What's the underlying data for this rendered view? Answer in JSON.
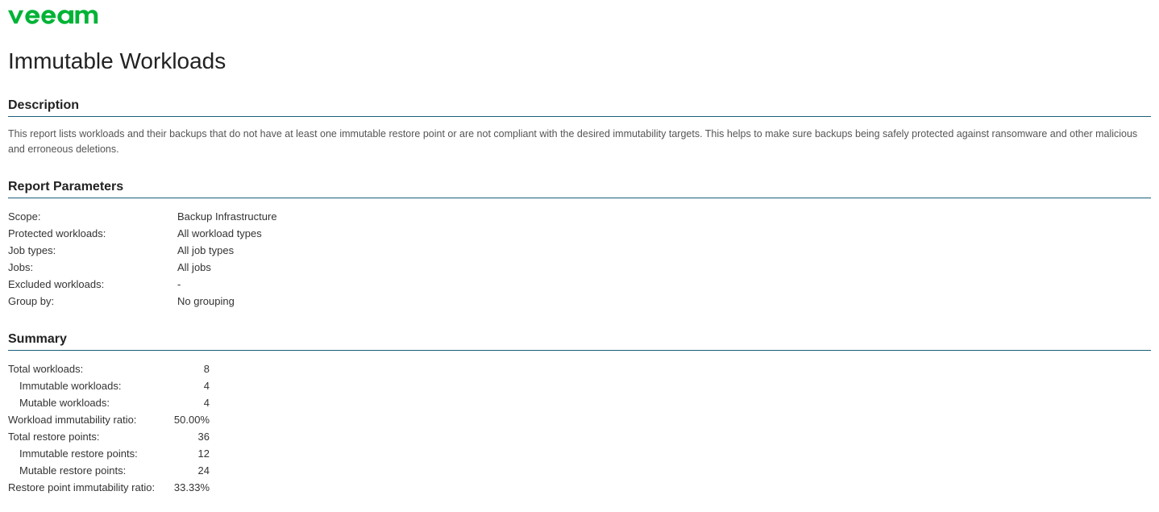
{
  "logo": {
    "name": "veeam"
  },
  "title": "Immutable Workloads",
  "sections": {
    "description": {
      "heading": "Description",
      "text": "This report lists workloads and their backups that do not have at least one immutable restore point or are not compliant with the desired immutability targets. This helps to make sure backups being safely protected against ransomware and other malicious and erroneous deletions."
    },
    "parameters": {
      "heading": "Report Parameters",
      "rows": [
        {
          "label": "Scope:",
          "value": "Backup Infrastructure"
        },
        {
          "label": "Protected workloads:",
          "value": "All workload types"
        },
        {
          "label": "Job types:",
          "value": "All job types"
        },
        {
          "label": "Jobs:",
          "value": "All jobs"
        },
        {
          "label": "Excluded workloads:",
          "value": "-"
        },
        {
          "label": "Group by:",
          "value": "No grouping"
        }
      ]
    },
    "summary": {
      "heading": "Summary",
      "rows": [
        {
          "label": "Total workloads:",
          "value": "8",
          "indent": false
        },
        {
          "label": "Immutable workloads:",
          "value": "4",
          "indent": true
        },
        {
          "label": "Mutable workloads:",
          "value": "4",
          "indent": true
        },
        {
          "label": "Workload immutability ratio:",
          "value": "50.00%",
          "indent": false
        },
        {
          "label": "Total restore points:",
          "value": "36",
          "indent": false
        },
        {
          "label": "Immutable restore points:",
          "value": "12",
          "indent": true
        },
        {
          "label": "Mutable restore points:",
          "value": "24",
          "indent": true
        },
        {
          "label": "Restore point immutability ratio:",
          "value": "33.33%",
          "indent": false
        }
      ]
    }
  }
}
